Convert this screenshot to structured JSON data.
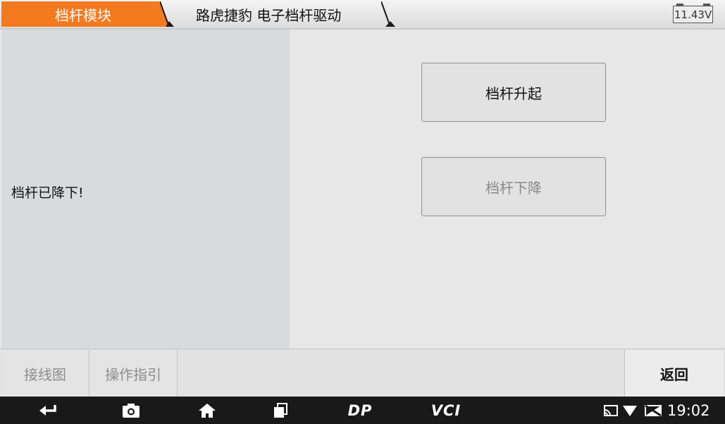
{
  "header": {
    "crumb_1": "档杆模块",
    "crumb_2": "路虎捷豹 电子档杆驱动",
    "battery_voltage": "11.43V"
  },
  "colors": {
    "accent": "#f47a1f",
    "left_panel": "#d8dadd",
    "content_bg": "#e7e7e7"
  },
  "main": {
    "status_text": "档杆已降下!",
    "raise_button": "档杆升起",
    "lower_button": "档杆下降"
  },
  "toolbar": {
    "wiring_diagram": "接线图",
    "operation_guide": "操作指引",
    "back": "返回"
  },
  "navbar": {
    "icons": [
      "back-icon",
      "camera-icon",
      "home-icon",
      "recent-apps-icon",
      "dp-icon",
      "vci-icon"
    ],
    "dp_label": "DP",
    "vci_label": "VCI",
    "status_icons": [
      "cast-icon",
      "wifi-icon",
      "no-sim-icon"
    ],
    "clock": "19:02"
  }
}
